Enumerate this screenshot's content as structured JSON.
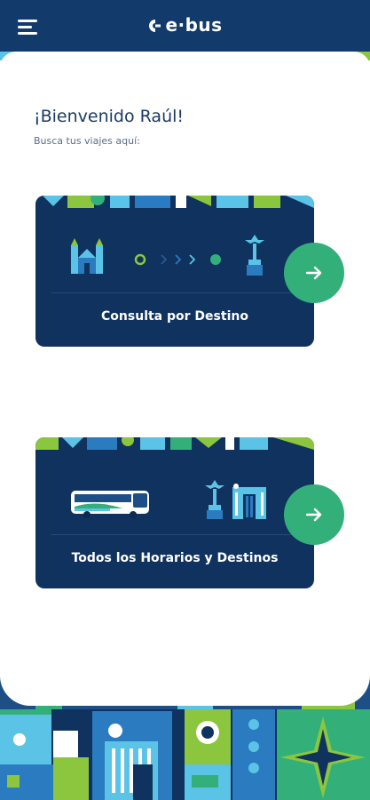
{
  "header": {
    "brand": "e·bus",
    "menu_icon": "menu-icon",
    "logo_icon": "ebus-logo-icon",
    "background_color": "#123a6b"
  },
  "greeting": {
    "title": "¡Bienvenido Raúl!",
    "subtitle": "Busca tus viajes aquí:"
  },
  "cards": [
    {
      "label": "Consulta por Destino",
      "icons": [
        "cathedral-icon",
        "origin-dot-icon",
        "route-arrows-icon",
        "destination-dot-icon",
        "monument-icon"
      ],
      "action_icon": "arrow-right-icon"
    },
    {
      "label": "Todos los Horarios y Destinos",
      "icons": [
        "bus-icon",
        "monument-icon",
        "arch-building-icon"
      ],
      "action_icon": "arrow-right-icon"
    }
  ],
  "colors": {
    "navy": "#10325f",
    "accent_green": "#33b07a",
    "light_blue": "#5bc3e6",
    "lime": "#8cc63f",
    "text_dark": "#1a3a64"
  }
}
